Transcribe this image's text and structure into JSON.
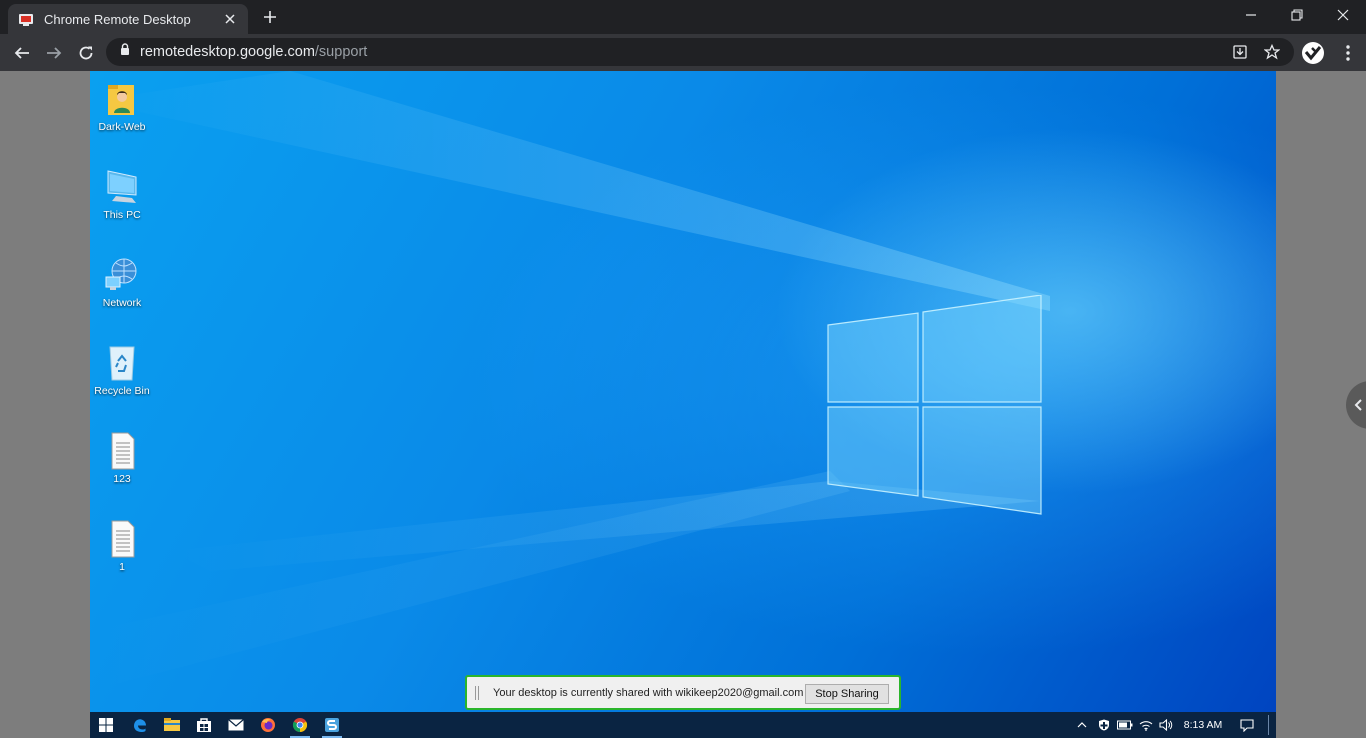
{
  "browser": {
    "tab_title": "Chrome Remote Desktop",
    "url_host": "remotedesktop.google.com",
    "url_path": "/support"
  },
  "desktop": {
    "icons": [
      {
        "label": "Dark-Web",
        "icon": "user-folder-icon"
      },
      {
        "label": "This PC",
        "icon": "computer-icon"
      },
      {
        "label": "Network",
        "icon": "network-icon"
      },
      {
        "label": "Recycle Bin",
        "icon": "recycle-bin-icon"
      },
      {
        "label": "123",
        "icon": "text-file-icon"
      },
      {
        "label": "1",
        "icon": "text-file-icon"
      }
    ]
  },
  "share_bar": {
    "message": "Your desktop is currently shared with wikikeep2020@gmail.com",
    "stop_label": "Stop Sharing",
    "border_color": "#2bb52b"
  },
  "taskbar": {
    "apps": [
      "start-icon",
      "edge-icon",
      "file-explorer-icon",
      "store-icon",
      "mail-icon",
      "firefox-icon",
      "chrome-icon",
      "app-s-icon"
    ],
    "clock": "8:13 AM"
  },
  "colors": {
    "tabstrip": "#202124",
    "toolbar": "#35363a",
    "desktop_blue": "#0a8ae8",
    "taskbar": "#0a2442"
  }
}
